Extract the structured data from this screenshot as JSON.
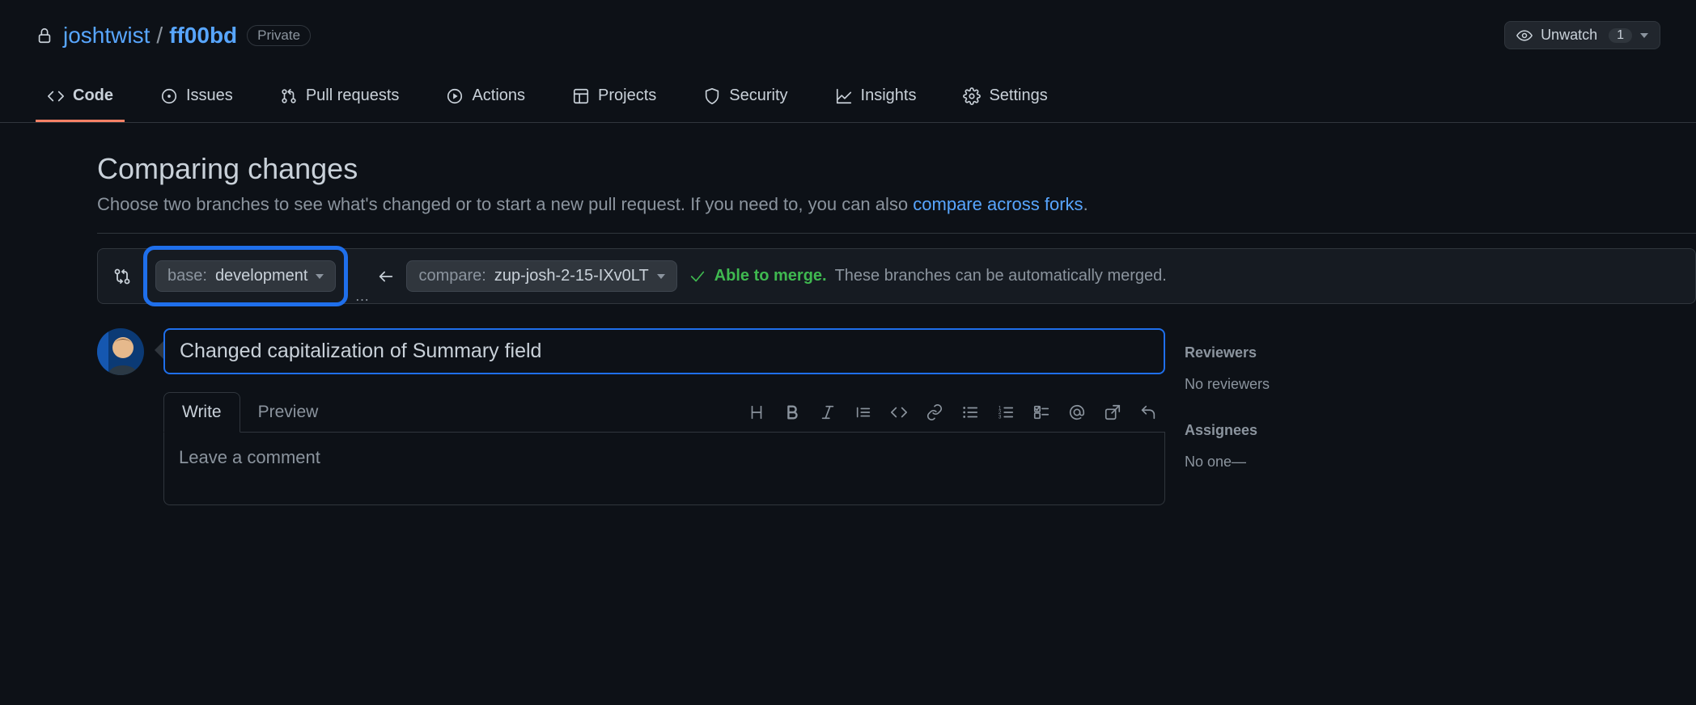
{
  "repo": {
    "owner": "joshtwist",
    "name": "ff00bd",
    "visibility": "Private"
  },
  "watch": {
    "label": "Unwatch",
    "count": "1"
  },
  "tabs": [
    {
      "id": "code",
      "label": "Code",
      "active": true
    },
    {
      "id": "issues",
      "label": "Issues"
    },
    {
      "id": "pulls",
      "label": "Pull requests"
    },
    {
      "id": "actions",
      "label": "Actions"
    },
    {
      "id": "projects",
      "label": "Projects"
    },
    {
      "id": "security",
      "label": "Security"
    },
    {
      "id": "insights",
      "label": "Insights"
    },
    {
      "id": "settings",
      "label": "Settings"
    }
  ],
  "page": {
    "title": "Comparing changes",
    "subtitle_pre": "Choose two branches to see what's changed or to start a new pull request. If you need to, you can also ",
    "subtitle_link": "compare across forks",
    "subtitle_post": "."
  },
  "compare": {
    "base_label": "base:",
    "base_value": "development",
    "compare_label": "compare:",
    "compare_value": "zup-josh-2-15-IXv0LT",
    "merge_ok": "Able to merge.",
    "merge_rest": "These branches can be automatically merged."
  },
  "pr": {
    "title_value": "Changed capitalization of Summary field",
    "write_tab": "Write",
    "preview_tab": "Preview",
    "comment_placeholder": "Leave a comment"
  },
  "sidebar": {
    "reviewers_title": "Reviewers",
    "reviewers_body": "No reviewers",
    "assignees_title": "Assignees",
    "assignees_body": "No one—"
  }
}
